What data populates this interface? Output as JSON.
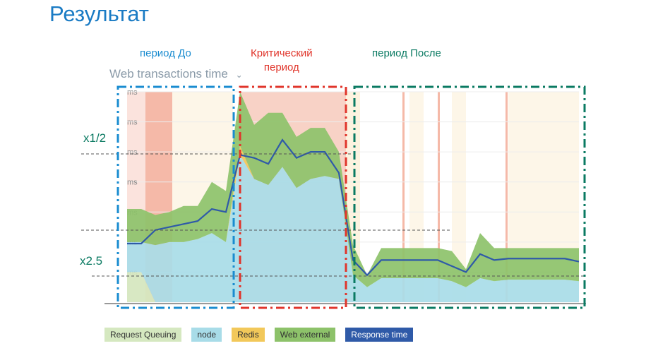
{
  "slide": {
    "title": "Результат"
  },
  "chart_header": {
    "title": "Web transactions time",
    "dropdown_icon": "chevron-down-icon"
  },
  "annotations": {
    "before": "период До",
    "critical_line1": "Критический",
    "critical_line2": "период",
    "after": "период После",
    "factor_half": "x1/2",
    "factor_25": "x2.5"
  },
  "colors": {
    "before": "#1a8cd0",
    "critical": "#e0352b",
    "after": "#0a7a62",
    "request_queuing": "#d5e8c0",
    "node": "#a8dce8",
    "redis": "#f2c85a",
    "web_external": "#8dc26a",
    "response_time": "#2f5aa8"
  },
  "chart_data": {
    "type": "area",
    "title": "Web transactions time",
    "ylabel": "",
    "y_tick_labels": [
      "ms",
      "ms",
      "ms",
      "ms",
      "ms",
      "ms",
      "ms"
    ],
    "ylim": [
      0,
      7
    ],
    "grid": true,
    "legend_placement": "bottom",
    "x": [
      0,
      1,
      2,
      3,
      4,
      5,
      6,
      7,
      8,
      9,
      10,
      11,
      12,
      13,
      14,
      15,
      16,
      17,
      18,
      19,
      20,
      21,
      22,
      23,
      24,
      25,
      26,
      27,
      28,
      29,
      30,
      31,
      32
    ],
    "series": [
      {
        "name": "Request Queuing",
        "values": [
          1.0,
          1.0,
          0,
          0,
          0,
          0,
          0,
          0,
          0,
          0,
          0,
          0,
          0,
          0,
          0,
          0,
          0,
          0,
          0,
          0,
          0,
          0,
          0,
          0,
          0,
          0,
          0,
          0,
          0,
          0,
          0,
          0,
          0
        ]
      },
      {
        "name": "node",
        "values": [
          1.0,
          1.0,
          1.9,
          2.0,
          2.0,
          2.1,
          2.3,
          2.0,
          4.9,
          4.1,
          3.9,
          4.5,
          3.8,
          4.1,
          4.2,
          4.1,
          0.9,
          0.5,
          0.8,
          0.8,
          0.8,
          0.8,
          0.8,
          0.7,
          0.5,
          0.8,
          0.7,
          0.75,
          0.75,
          0.75,
          0.75,
          0.75,
          0.7
        ]
      },
      {
        "name": "Redis",
        "values": [
          0,
          0,
          0,
          0,
          0,
          0,
          0,
          0,
          0.3,
          0,
          0,
          0,
          0,
          0,
          0,
          0,
          0,
          0,
          0,
          0,
          0,
          0,
          0,
          0,
          0,
          0,
          0,
          0,
          0,
          0,
          0,
          0,
          0
        ]
      },
      {
        "name": "Web external",
        "values": [
          1.1,
          1.1,
          1.0,
          1.0,
          1.2,
          1.1,
          1.7,
          1.7,
          2.0,
          1.8,
          2.4,
          1.8,
          1.7,
          1.7,
          1.6,
          0.9,
          1.0,
          0.4,
          1.0,
          1.0,
          1.0,
          1.0,
          1.0,
          1.0,
          0.6,
          1.5,
          1.1,
          1.05,
          1.05,
          1.05,
          1.05,
          1.05,
          1.1
        ]
      },
      {
        "name": "Response time",
        "values": [
          1.95,
          1.95,
          2.4,
          2.5,
          2.6,
          2.7,
          3.1,
          3.0,
          4.9,
          4.8,
          4.6,
          5.4,
          4.8,
          5.0,
          5.0,
          4.3,
          1.4,
          0.9,
          1.4,
          1.4,
          1.4,
          1.4,
          1.4,
          1.2,
          1.0,
          1.6,
          1.4,
          1.45,
          1.45,
          1.45,
          1.45,
          1.45,
          1.35
        ]
      }
    ]
  }
}
